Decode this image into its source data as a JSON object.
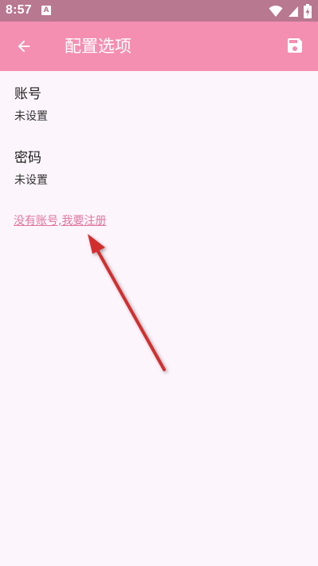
{
  "status_bar": {
    "time": "8:57",
    "notification_badge": "A",
    "icons": [
      "wifi-icon",
      "signal-icon",
      "battery-icon"
    ]
  },
  "app_bar": {
    "title": "配置选项",
    "background_color": "#f48fb1",
    "back_icon": "arrow-left-icon",
    "save_icon": "floppy-disk-icon"
  },
  "preferences": [
    {
      "title": "账号",
      "summary": "未设置"
    },
    {
      "title": "密码",
      "summary": "未设置"
    }
  ],
  "register_link": "没有账号,我要注册",
  "annotation": {
    "color": "#d32f2f",
    "target": "register-link"
  }
}
